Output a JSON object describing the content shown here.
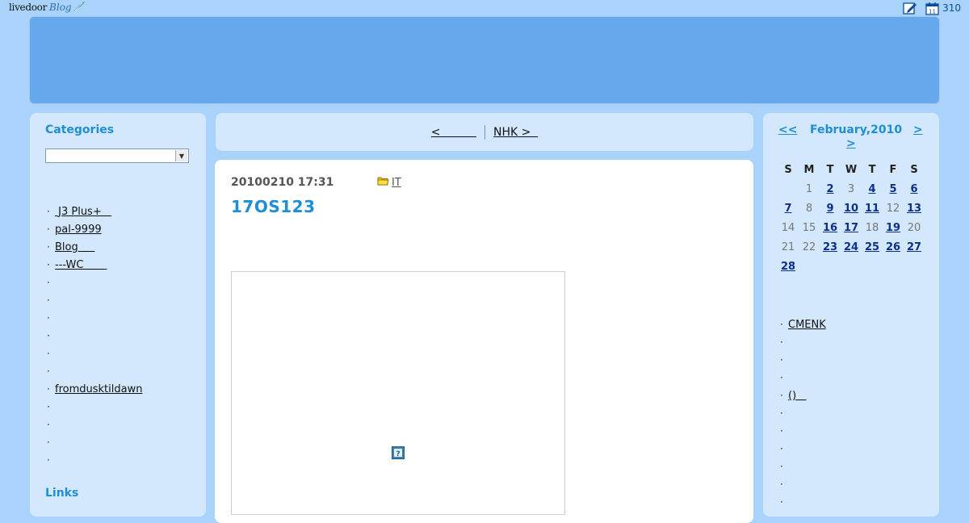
{
  "topbar": {
    "logo_main": "livedoor",
    "logo_blog": "Blog",
    "count": "310",
    "icons": [
      "edit-icon",
      "calendar-icon"
    ],
    "calendar_icon_day": "11"
  },
  "left": {
    "categories_title": "Categories",
    "category_select_value": "",
    "links": [
      {
        "text": " J3 Plus+   "
      },
      {
        "text": "pal-9999"
      },
      {
        "text": "Blog     "
      },
      {
        "text": "---WC       "
      },
      {
        "text": ""
      },
      {
        "text": ""
      },
      {
        "text": ""
      },
      {
        "text": ""
      },
      {
        "text": ""
      },
      {
        "text": ""
      },
      {
        "text": "fromdusktildawn"
      },
      {
        "text": ""
      },
      {
        "text": ""
      },
      {
        "text": ""
      },
      {
        "text": ""
      }
    ],
    "links_title": "Links"
  },
  "nav": {
    "prev": "<          ",
    "next": "NHK >  "
  },
  "post": {
    "date": "20100210 17:31",
    "category": "IT",
    "title": "17OS123"
  },
  "calendar": {
    "prev": "<<",
    "title": "February,2010",
    "next": ">",
    "next2": ">",
    "weekdays": [
      "S",
      "M",
      "T",
      "W",
      "T",
      "F",
      "S"
    ],
    "weeks": [
      [
        {
          "d": ""
        },
        {
          "d": "1",
          "link": false
        },
        {
          "d": "2",
          "link": true
        },
        {
          "d": "3",
          "link": false
        },
        {
          "d": "4",
          "link": true
        },
        {
          "d": "5",
          "link": true
        },
        {
          "d": "6",
          "link": true
        }
      ],
      [
        {
          "d": "7",
          "link": true
        },
        {
          "d": "8",
          "link": false
        },
        {
          "d": "9",
          "link": true
        },
        {
          "d": "10",
          "link": true
        },
        {
          "d": "11",
          "link": true
        },
        {
          "d": "12",
          "link": false
        },
        {
          "d": "13",
          "link": true
        }
      ],
      [
        {
          "d": "14",
          "link": false
        },
        {
          "d": "15",
          "link": false
        },
        {
          "d": "16",
          "link": true
        },
        {
          "d": "17",
          "link": true
        },
        {
          "d": "18",
          "link": false
        },
        {
          "d": "19",
          "link": true
        },
        {
          "d": "20",
          "link": false
        }
      ],
      [
        {
          "d": "21",
          "link": false
        },
        {
          "d": "22",
          "link": false
        },
        {
          "d": "23",
          "link": true
        },
        {
          "d": "24",
          "link": true
        },
        {
          "d": "25",
          "link": true
        },
        {
          "d": "26",
          "link": true
        },
        {
          "d": "27",
          "link": true
        }
      ],
      [
        {
          "d": "28",
          "link": true
        },
        {
          "d": ""
        },
        {
          "d": ""
        },
        {
          "d": ""
        },
        {
          "d": ""
        },
        {
          "d": ""
        },
        {
          "d": ""
        }
      ]
    ]
  },
  "right": {
    "links": [
      {
        "text": "CMENK"
      },
      {
        "text": ""
      },
      {
        "text": ""
      },
      {
        "text": ""
      },
      {
        "text": "()   "
      },
      {
        "text": ""
      },
      {
        "text": ""
      },
      {
        "text": ""
      },
      {
        "text": ""
      },
      {
        "text": ""
      },
      {
        "text": ""
      }
    ]
  },
  "colors": {
    "background": "#a9d3fa",
    "header": "#65a8ec",
    "panel": "#d3e8fc",
    "accent": "#1e8ed6"
  }
}
